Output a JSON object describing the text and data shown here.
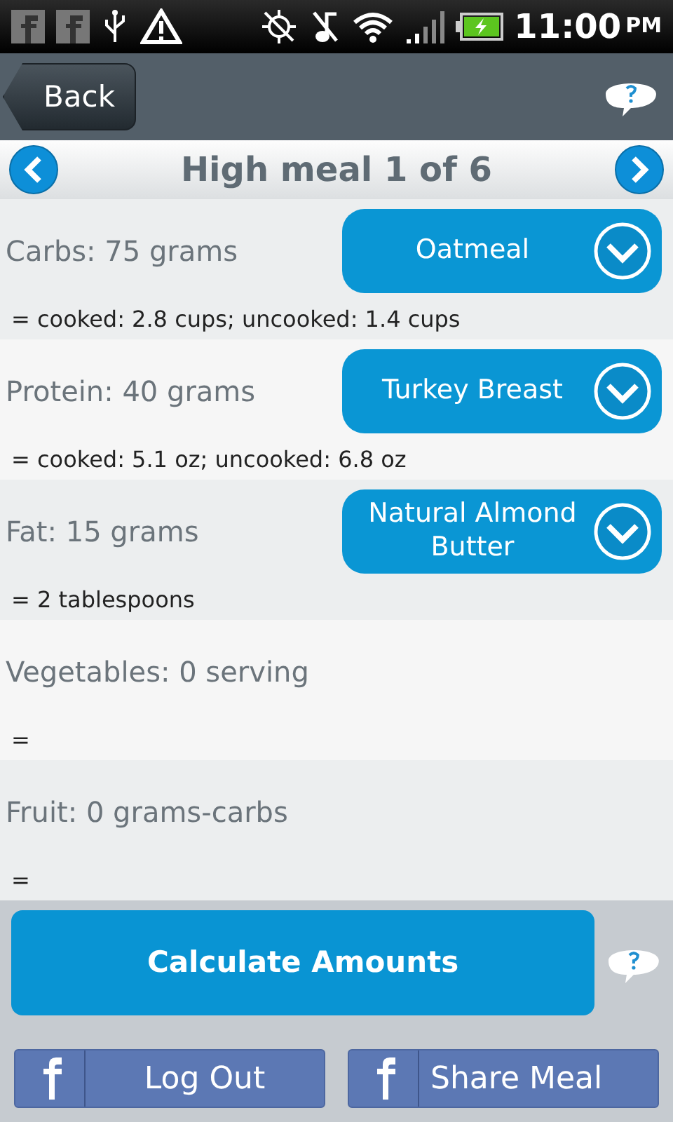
{
  "status_bar": {
    "time": "11:00",
    "ampm": "PM"
  },
  "header": {
    "back": "Back"
  },
  "title": "High meal 1 of 6",
  "rows": [
    {
      "label": "Carbs: 75 grams",
      "food": "Oatmeal",
      "amount": "= cooked: 2.8 cups; uncooked: 1.4 cups"
    },
    {
      "label": "Protein: 40 grams",
      "food": "Turkey Breast",
      "amount": "= cooked: 5.1 oz; uncooked: 6.8 oz"
    },
    {
      "label": "Fat: 15 grams",
      "food": "Natural Almond Butter",
      "amount": "= 2 tablespoons"
    },
    {
      "label": "Vegetables: 0 serving",
      "amount": "="
    },
    {
      "label": "Fruit: 0 grams-carbs",
      "amount": "="
    }
  ],
  "calculate": "Calculate Amounts",
  "facebook_buttons": [
    "Log Out",
    "Share Meal"
  ]
}
